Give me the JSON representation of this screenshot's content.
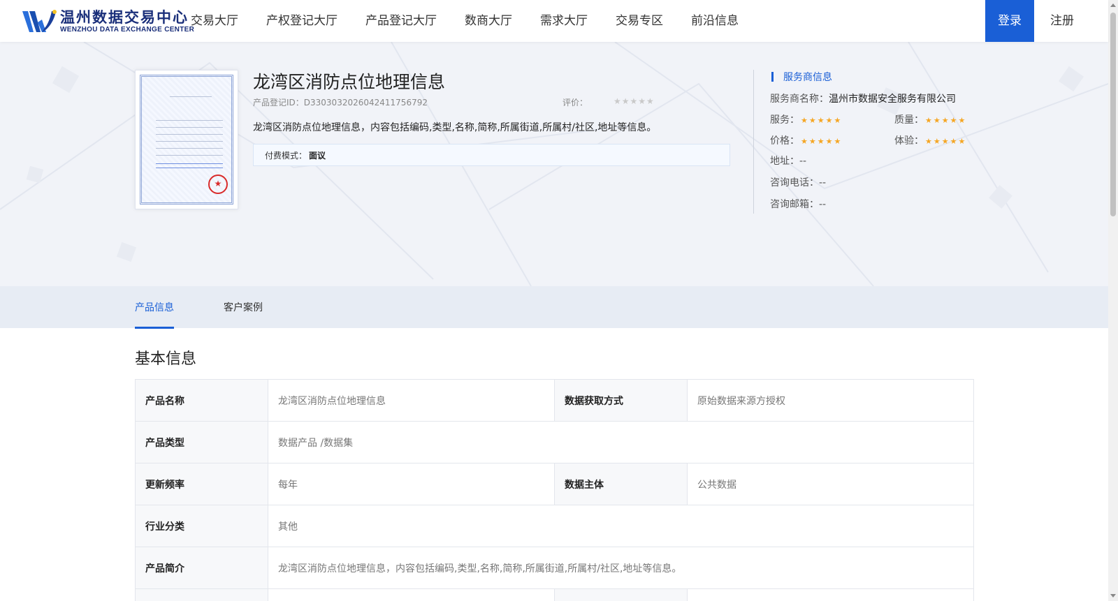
{
  "header": {
    "logo_cn": "温州数据交易中心",
    "logo_en": "WENZHOU DATA EXCHANGE CENTER",
    "nav": [
      "交易大厅",
      "产权登记大厅",
      "产品登记大厅",
      "数商大厅",
      "需求大厅",
      "交易专区",
      "前沿信息"
    ],
    "login_label": "登录",
    "register_label": "注册"
  },
  "product": {
    "title": "龙湾区消防点位地理信息",
    "id_label": "产品登记ID：D33030320260424117567​92",
    "rating_label": "评价：",
    "rating_stars": "★★★★★",
    "description": "龙湾区消防点位地理信息，内容包括编码,类型,名称,简称,所属街道,所属村/社区,地址等信息。",
    "pay_label": "付费模式：",
    "pay_value": "面议"
  },
  "provider": {
    "section_title": "服务商信息",
    "name_label": "服务商名称：",
    "name_value": "温州市数据安全服务有限公司",
    "ratings": [
      {
        "label": "服务：",
        "stars": "★★★★★"
      },
      {
        "label": "质量：",
        "stars": "★★★★★"
      },
      {
        "label": "价格：",
        "stars": "★★★★★"
      },
      {
        "label": "体验：",
        "stars": "★★★★★"
      }
    ],
    "address": "地址：--",
    "phone": "咨询电话：--",
    "email": "咨询邮箱：--"
  },
  "tabs": [
    "产品信息",
    "客户案例"
  ],
  "basic_info": {
    "title": "基本信息",
    "rows": [
      {
        "l1": "产品名称",
        "v1": "龙湾区消防点位地理信息",
        "l2": "数据获取方式",
        "v2": "原始数据来源方授权"
      },
      {
        "l1": "产品类型",
        "v1": "数据产品 /数据集"
      },
      {
        "l1": "更新频率",
        "v1": "每年",
        "l2": "数据主体",
        "v2": "公共数据"
      },
      {
        "l1": "行业分类",
        "v1": "其他"
      },
      {
        "l1": "产品简介",
        "v1": "龙湾区消防点位地理信息，内容包括编码,类型,名称,简称,所属街道,所属村/社区,地址等信息。"
      }
    ]
  },
  "colors": {
    "primary": "#1a5fd6",
    "star": "#f5a623",
    "hero_bg": "#f1f3f8",
    "tab_bg": "#e7ecf4"
  }
}
